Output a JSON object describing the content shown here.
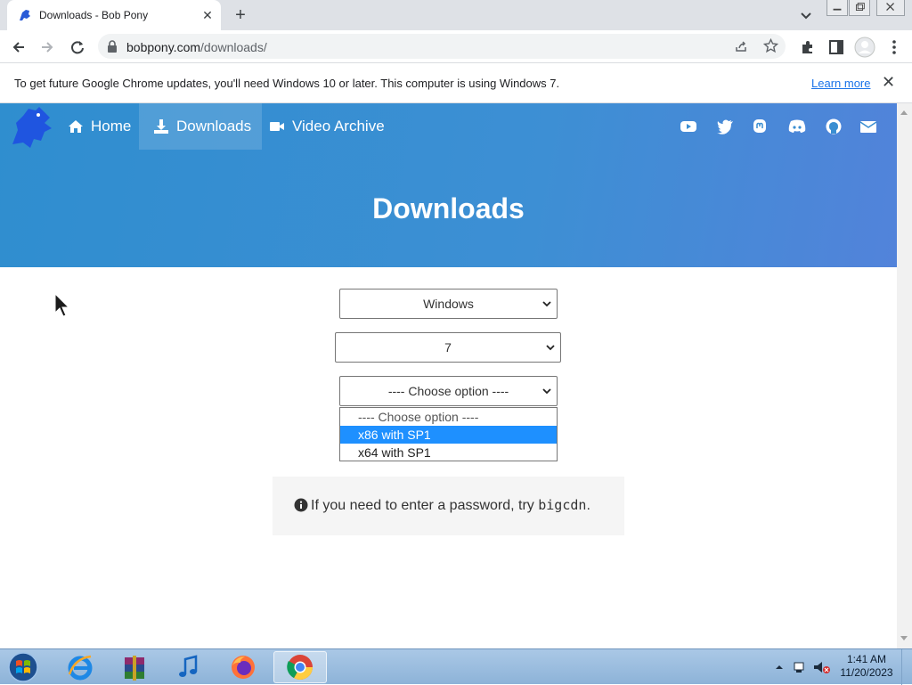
{
  "browser": {
    "tab_title": "Downloads - Bob Pony",
    "url_host": "bobpony.com",
    "url_path": "/downloads/"
  },
  "infobar": {
    "message": "To get future Google Chrome updates, you'll need Windows 10 or later. This computer is using Windows 7.",
    "link": "Learn more"
  },
  "nav": {
    "items": [
      {
        "label": "Home",
        "icon": "home-icon"
      },
      {
        "label": "Downloads",
        "icon": "download-icon"
      },
      {
        "label": "Video Archive",
        "icon": "video-icon"
      }
    ],
    "social": [
      "youtube-icon",
      "twitter-icon",
      "mastodon-icon",
      "discord-icon",
      "github-icon",
      "email-icon"
    ]
  },
  "hero": {
    "title": "Downloads"
  },
  "form": {
    "os_value": "Windows",
    "version_value": "7",
    "option_value": "---- Choose option ----",
    "options": [
      "---- Choose option ----",
      "x86 with SP1",
      "x64 with SP1"
    ],
    "highlighted_index": 1
  },
  "notice": {
    "text": "If you need to enter a password, try ",
    "code": "bigcdn",
    "suffix": "."
  },
  "taskbar": {
    "apps": [
      "internet-explorer-icon",
      "winrar-icon",
      "itunes-icon",
      "firefox-icon",
      "chrome-icon"
    ],
    "time": "1:41 AM",
    "date": "11/20/2023"
  },
  "colors": {
    "hero_start": "#2f8ecf",
    "hero_end": "#5283da",
    "selection": "#1e90ff",
    "link": "#1a73e8"
  }
}
